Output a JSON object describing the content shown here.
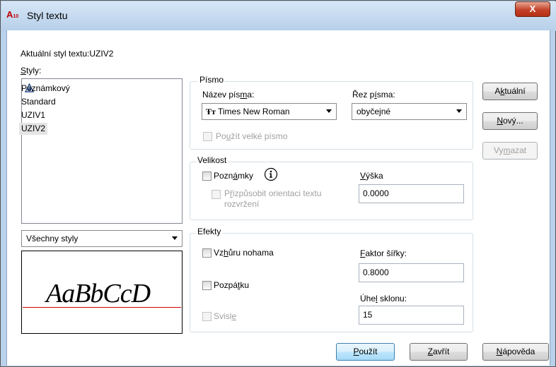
{
  "window": {
    "title": "Styl textu",
    "app_icon_text": "A",
    "app_icon_sub": "10",
    "close_label": "X"
  },
  "current_style": {
    "label": "Aktuální styl textu:",
    "value": "UZIV2"
  },
  "styles": {
    "label": "Styly:",
    "items": [
      {
        "name": "Poznámkový",
        "annotative": true,
        "selected": false
      },
      {
        "name": "Standard",
        "annotative": false,
        "selected": false
      },
      {
        "name": "UZIV1",
        "annotative": false,
        "selected": false
      },
      {
        "name": "UZIV2",
        "annotative": false,
        "selected": true
      }
    ],
    "filter": "Všechny styly"
  },
  "font": {
    "group_title": "Písmo",
    "name_label": "Název písma:",
    "name_value": "Times New Roman",
    "style_label": "Řez písma:",
    "style_value": "obyčejné",
    "bigfont_label": "Použít velké písmo",
    "bigfont_checked": false,
    "bigfont_enabled": false
  },
  "size": {
    "group_title": "Velikost",
    "annotative_label": "Poznámky",
    "annotative_checked": false,
    "match_label_line1": "Přizpůsobit orientaci textu",
    "match_label_line2": "rozvržení",
    "match_enabled": false,
    "height_label": "Výška",
    "height_value": "0.0000"
  },
  "effects": {
    "group_title": "Efekty",
    "upside_down_label": "Vzhůru nohama",
    "upside_down_checked": false,
    "backwards_label": "Pozpátku",
    "backwards_checked": false,
    "vertical_label": "Svisle",
    "vertical_enabled": false,
    "width_factor_label": "Faktor šířky:",
    "width_factor_value": "0.8000",
    "oblique_label": "Úhel sklonu:",
    "oblique_value": "15"
  },
  "preview": {
    "text": "AaBbCcD",
    "baseline_color": "#d00000"
  },
  "buttons": {
    "set_current": "Aktuální",
    "new": "Nový...",
    "delete": "Vymazat",
    "apply": "Použít",
    "close": "Zavřít",
    "help": "Nápověda"
  },
  "icons": {
    "annotative": "annotative-triangle-icon",
    "info": "info-icon",
    "font_type": "truetype-icon"
  },
  "colors": {
    "title_gradient_top": "#d6e6f7",
    "close_red": "#c4422a",
    "default_button_border": "#3c7fb1"
  }
}
